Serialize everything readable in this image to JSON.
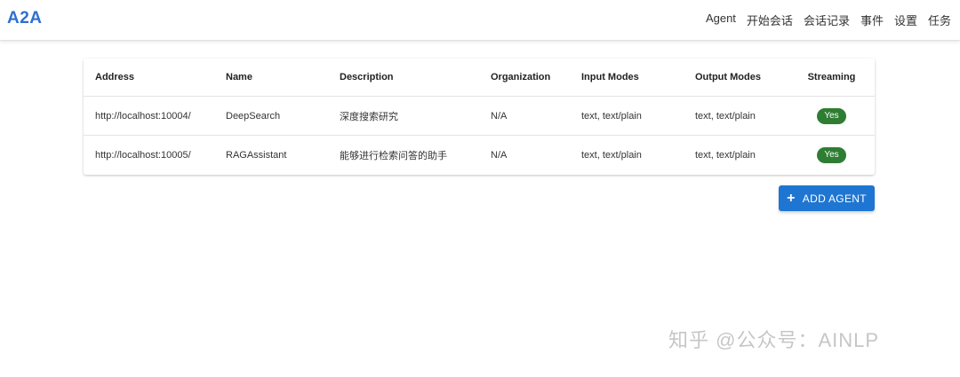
{
  "app": {
    "title": "A2A"
  },
  "nav": {
    "items": [
      {
        "label": "Agent"
      },
      {
        "label": "开始会话"
      },
      {
        "label": "会话记录"
      },
      {
        "label": "事件"
      },
      {
        "label": "设置"
      },
      {
        "label": "任务"
      }
    ]
  },
  "table": {
    "headers": [
      "Address",
      "Name",
      "Description",
      "Organization",
      "Input Modes",
      "Output Modes",
      "Streaming"
    ],
    "rows": [
      {
        "address": "http://localhost:10004/",
        "name": "DeepSearch",
        "description": "深度搜索研究",
        "organization": "N/A",
        "input_modes": "text, text/plain",
        "output_modes": "text, text/plain",
        "streaming": "Yes"
      },
      {
        "address": "http://localhost:10005/",
        "name": "RAGAssistant",
        "description": "能够进行检索问答的助手",
        "organization": "N/A",
        "input_modes": "text, text/plain",
        "output_modes": "text, text/plain",
        "streaming": "Yes"
      }
    ]
  },
  "actions": {
    "add_agent_label": "ADD AGENT",
    "add_icon": "plus-icon"
  },
  "watermark": {
    "text": "知乎 @公众号：AINLP"
  },
  "colors": {
    "brand": "#2f6fd0",
    "button": "#1e76d2",
    "chip": "#2e7d32"
  }
}
